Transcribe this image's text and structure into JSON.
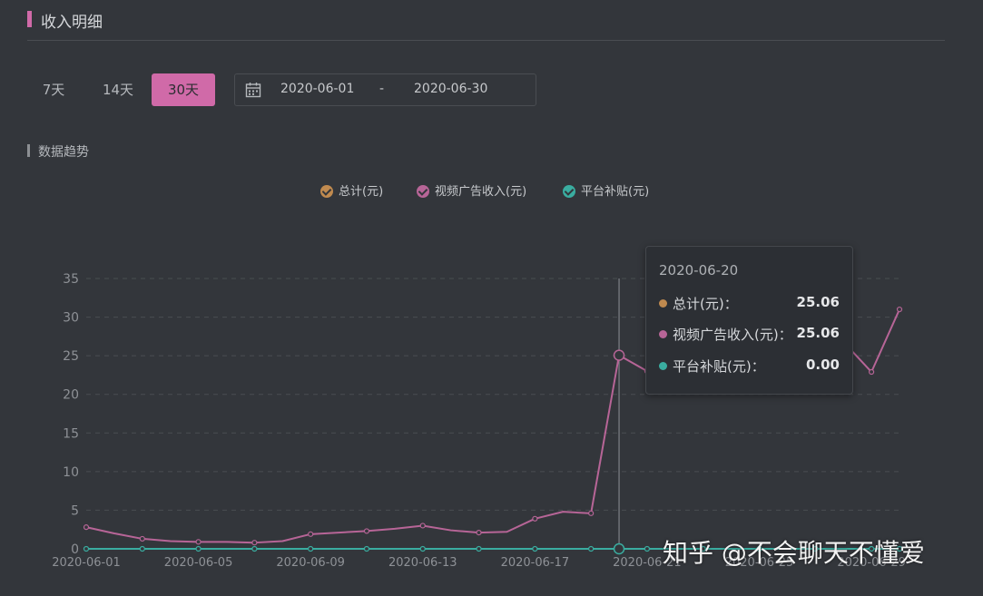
{
  "header": {
    "title": "收入明细"
  },
  "range_tabs": [
    {
      "label": "7天",
      "active": false
    },
    {
      "label": "14天",
      "active": false
    },
    {
      "label": "30天",
      "active": true
    }
  ],
  "date_range": {
    "start": "2020-06-01",
    "separator": "-",
    "end": "2020-06-30"
  },
  "section": {
    "title": "数据趋势"
  },
  "legend": [
    {
      "label": "总计(元)",
      "color": "#c08a4f"
    },
    {
      "label": "视频广告收入(元)",
      "color": "#b76597"
    },
    {
      "label": "平台补贴(元)",
      "color": "#3aada0"
    }
  ],
  "tooltip": {
    "date": "2020-06-20",
    "rows": [
      {
        "name": "总计(元)：",
        "value": "25.06",
        "color": "#c08a4f"
      },
      {
        "name": "视频广告收入(元)：",
        "value": "25.06",
        "color": "#b76597"
      },
      {
        "name": "平台补贴(元)：",
        "value": "0.00",
        "color": "#3aada0"
      }
    ]
  },
  "chart_data": {
    "type": "line",
    "x": [
      "2020-06-01",
      "2020-06-02",
      "2020-06-03",
      "2020-06-04",
      "2020-06-05",
      "2020-06-06",
      "2020-06-07",
      "2020-06-08",
      "2020-06-09",
      "2020-06-10",
      "2020-06-11",
      "2020-06-12",
      "2020-06-13",
      "2020-06-14",
      "2020-06-15",
      "2020-06-16",
      "2020-06-17",
      "2020-06-18",
      "2020-06-19",
      "2020-06-20",
      "2020-06-21",
      "2020-06-22",
      "2020-06-23",
      "2020-06-24",
      "2020-06-25",
      "2020-06-26",
      "2020-06-27",
      "2020-06-28",
      "2020-06-29",
      "2020-06-30"
    ],
    "x_tick_labels": [
      "2020-06-01",
      "2020-06-05",
      "2020-06-09",
      "2020-06-13",
      "2020-06-17",
      "2020-06-21",
      "2020-06-25",
      "2020-06-29"
    ],
    "ylim": [
      0,
      35
    ],
    "y_ticks": [
      0,
      5,
      10,
      15,
      20,
      25,
      30,
      35
    ],
    "grid": true,
    "series": [
      {
        "name": "视频广告收入(元)",
        "color": "#b76597",
        "values": [
          2.8,
          2.0,
          1.3,
          1.0,
          0.9,
          0.9,
          0.8,
          1.0,
          1.9,
          2.1,
          2.3,
          2.6,
          3.0,
          2.4,
          2.1,
          2.2,
          3.9,
          4.8,
          4.6,
          25.06,
          23.0,
          22.0,
          22.5,
          23.5,
          24.5,
          25.0,
          26.0,
          26.8,
          22.9,
          31.0
        ]
      },
      {
        "name": "平台补贴(元)",
        "color": "#3aada0",
        "values": [
          0,
          0,
          0,
          0,
          0,
          0,
          0,
          0,
          0,
          0,
          0,
          0,
          0,
          0,
          0,
          0,
          0,
          0,
          0,
          0,
          0,
          0,
          0,
          0,
          0,
          0,
          0,
          0,
          0,
          0
        ]
      }
    ],
    "highlight_index": 19
  },
  "watermark": "知乎 @不会聊天不懂爱"
}
